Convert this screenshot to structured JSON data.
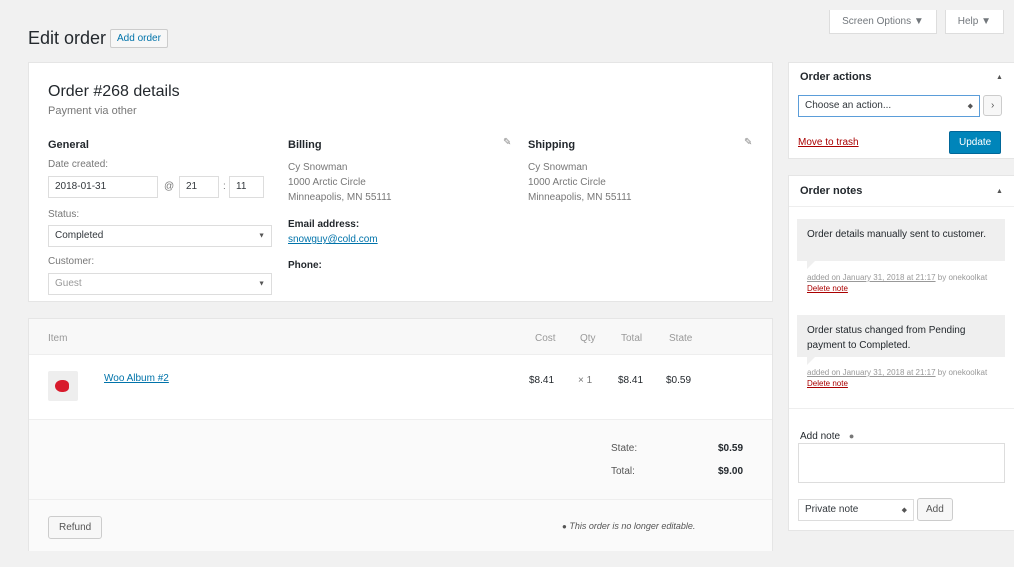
{
  "header": {
    "screen_options": "Screen Options ▼",
    "help": "Help ▼",
    "title": "Edit order",
    "add_order": "Add order"
  },
  "order": {
    "title": "Order #268 details",
    "payment": "Payment via other",
    "general": {
      "heading": "General",
      "date_label": "Date created:",
      "date": "2018-01-31",
      "at": "@",
      "hour": "21",
      "colon": ":",
      "minute": "11",
      "status_label": "Status:",
      "status": "Completed",
      "customer_label": "Customer:",
      "customer": "Guest"
    },
    "billing": {
      "heading": "Billing",
      "lines": [
        "Cy Snowman",
        "1000 Arctic Circle",
        "Minneapolis, MN 55111"
      ],
      "email_label": "Email address:",
      "email": "snowguy@cold.com",
      "phone_label": "Phone:"
    },
    "shipping": {
      "heading": "Shipping",
      "lines": [
        "Cy Snowman",
        "1000 Arctic Circle",
        "Minneapolis, MN 55111"
      ]
    }
  },
  "items": {
    "headers": {
      "item": "Item",
      "cost": "Cost",
      "qty": "Qty",
      "total": "Total",
      "state": "State"
    },
    "rows": [
      {
        "name": "Woo Album #2",
        "cost": "$8.41",
        "qty": "× 1",
        "total": "$8.41",
        "state": "$0.59"
      }
    ],
    "totals": {
      "state_label": "State:",
      "state": "$0.59",
      "total_label": "Total:",
      "total": "$9.00"
    },
    "refund": "Refund",
    "not_editable": "This order is no longer editable.",
    "info_icon": "info-icon"
  },
  "sidebar": {
    "actions": {
      "title": "Order actions",
      "select": "Choose an action...",
      "go": "›",
      "trash": "Move to trash",
      "update": "Update"
    },
    "notes": {
      "title": "Order notes",
      "list": [
        {
          "text": "Order details manually sent to customer.",
          "meta_date": "added on January 31, 2018 at 21:17",
          "meta_by": "by",
          "meta_user": "onekoolkat",
          "delete": "Delete note"
        },
        {
          "text": "Order status changed from Pending payment to Completed.",
          "meta_date": "added on January 31, 2018 at 21:17",
          "meta_by": "by",
          "meta_user": "onekoolkat",
          "delete": "Delete note"
        }
      ],
      "add_label": "Add note",
      "note_type": "Private note",
      "add_button": "Add"
    }
  },
  "colors": {
    "primary": "#0085ba",
    "link": "#0073aa",
    "danger": "#a00",
    "product": "#d81b2c"
  }
}
